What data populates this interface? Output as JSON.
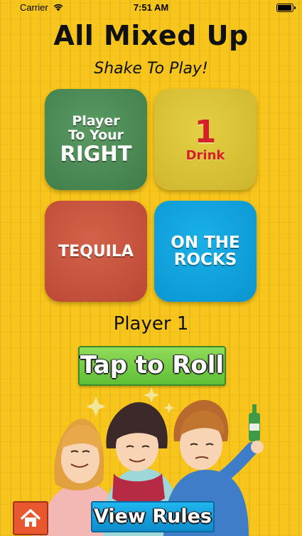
{
  "status": {
    "carrier": "Carrier",
    "time": "7:51 AM",
    "icons": [
      "wifi-icon",
      "battery-icon"
    ]
  },
  "header": {
    "title": "All Mixed Up",
    "subtitle": "Shake To Play!"
  },
  "tiles": {
    "top_left": {
      "line1": "Player",
      "line2": "To Your",
      "line3": "RIGHT",
      "color": "#4a8a55"
    },
    "top_right": {
      "number": "1",
      "label": "Drink",
      "color": "#dcc53a",
      "text_color": "#d4202a"
    },
    "bottom_left": {
      "label": "TEQUILA",
      "color": "#c8543e"
    },
    "bottom_right": {
      "line1": "ON THE",
      "line2": "ROCKS",
      "color": "#14a3de"
    }
  },
  "player": {
    "label": "Player 1"
  },
  "buttons": {
    "roll_label": "Tap to Roll",
    "rules_label": "View Rules",
    "home_icon": "home-icon"
  },
  "illustration": {
    "icon": "friends-drinking-illustration"
  }
}
